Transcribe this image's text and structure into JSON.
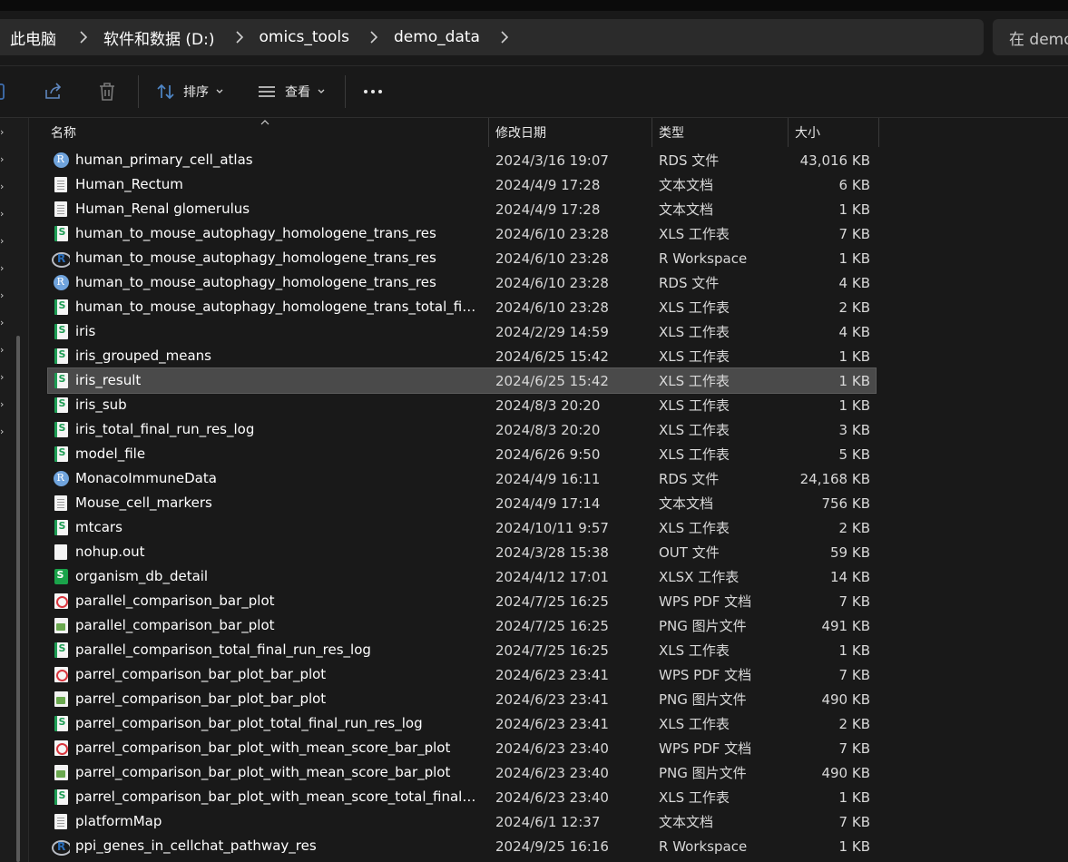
{
  "breadcrumb": [
    "此电脑",
    "软件和数据 (D:)",
    "omics_tools",
    "demo_data"
  ],
  "search_placeholder": "在 demo",
  "toolbar": {
    "sort_label": "排序",
    "view_label": "查看"
  },
  "columns": {
    "name": "名称",
    "date": "修改日期",
    "type": "类型",
    "size": "大小"
  },
  "files": [
    {
      "name": "human_primary_cell_atlas",
      "date": "2024/3/16 19:07",
      "type": "RDS 文件",
      "size": "43,016 KB",
      "icon": "rds"
    },
    {
      "name": "Human_Rectum",
      "date": "2024/4/9 17:28",
      "type": "文本文档",
      "size": "6 KB",
      "icon": "doc"
    },
    {
      "name": "Human_Renal glomerulus",
      "date": "2024/4/9 17:28",
      "type": "文本文档",
      "size": "1 KB",
      "icon": "doc"
    },
    {
      "name": "human_to_mouse_autophagy_homologene_trans_res",
      "date": "2024/6/10 23:28",
      "type": "XLS 工作表",
      "size": "7 KB",
      "icon": "xls"
    },
    {
      "name": "human_to_mouse_autophagy_homologene_trans_res",
      "date": "2024/6/10 23:28",
      "type": "R Workspace",
      "size": "1 KB",
      "icon": "rws"
    },
    {
      "name": "human_to_mouse_autophagy_homologene_trans_res",
      "date": "2024/6/10 23:28",
      "type": "RDS 文件",
      "size": "4 KB",
      "icon": "rds"
    },
    {
      "name": "human_to_mouse_autophagy_homologene_trans_total_fina...",
      "date": "2024/6/10 23:28",
      "type": "XLS 工作表",
      "size": "2 KB",
      "icon": "xls"
    },
    {
      "name": "iris",
      "date": "2024/2/29 14:59",
      "type": "XLS 工作表",
      "size": "4 KB",
      "icon": "xls"
    },
    {
      "name": "iris_grouped_means",
      "date": "2024/6/25 15:42",
      "type": "XLS 工作表",
      "size": "1 KB",
      "icon": "xls"
    },
    {
      "name": "iris_result",
      "date": "2024/6/25 15:42",
      "type": "XLS 工作表",
      "size": "1 KB",
      "icon": "xls",
      "selected": true
    },
    {
      "name": "iris_sub",
      "date": "2024/8/3 20:20",
      "type": "XLS 工作表",
      "size": "1 KB",
      "icon": "xls"
    },
    {
      "name": "iris_total_final_run_res_log",
      "date": "2024/8/3 20:20",
      "type": "XLS 工作表",
      "size": "3 KB",
      "icon": "xls"
    },
    {
      "name": "model_file",
      "date": "2024/6/26 9:50",
      "type": "XLS 工作表",
      "size": "5 KB",
      "icon": "xls"
    },
    {
      "name": "MonacoImmuneData",
      "date": "2024/4/9 16:11",
      "type": "RDS 文件",
      "size": "24,168 KB",
      "icon": "rds"
    },
    {
      "name": "Mouse_cell_markers",
      "date": "2024/4/9 17:14",
      "type": "文本文档",
      "size": "756 KB",
      "icon": "doc"
    },
    {
      "name": "mtcars",
      "date": "2024/10/11 9:57",
      "type": "XLS 工作表",
      "size": "2 KB",
      "icon": "xls"
    },
    {
      "name": "nohup.out",
      "date": "2024/3/28 15:38",
      "type": "OUT 文件",
      "size": "59 KB",
      "icon": "blank"
    },
    {
      "name": "organism_db_detail",
      "date": "2024/4/12 17:01",
      "type": "XLSX 工作表",
      "size": "14 KB",
      "icon": "xlsx"
    },
    {
      "name": "parallel_comparison_bar_plot",
      "date": "2024/7/25 16:25",
      "type": "WPS PDF 文档",
      "size": "7 KB",
      "icon": "pdf"
    },
    {
      "name": "parallel_comparison_bar_plot",
      "date": "2024/7/25 16:25",
      "type": "PNG 图片文件",
      "size": "491 KB",
      "icon": "png"
    },
    {
      "name": "parallel_comparison_total_final_run_res_log",
      "date": "2024/7/25 16:25",
      "type": "XLS 工作表",
      "size": "1 KB",
      "icon": "xls"
    },
    {
      "name": "parrel_comparison_bar_plot_bar_plot",
      "date": "2024/6/23 23:41",
      "type": "WPS PDF 文档",
      "size": "7 KB",
      "icon": "pdf"
    },
    {
      "name": "parrel_comparison_bar_plot_bar_plot",
      "date": "2024/6/23 23:41",
      "type": "PNG 图片文件",
      "size": "490 KB",
      "icon": "png"
    },
    {
      "name": "parrel_comparison_bar_plot_total_final_run_res_log",
      "date": "2024/6/23 23:41",
      "type": "XLS 工作表",
      "size": "2 KB",
      "icon": "xls"
    },
    {
      "name": "parrel_comparison_bar_plot_with_mean_score_bar_plot",
      "date": "2024/6/23 23:40",
      "type": "WPS PDF 文档",
      "size": "7 KB",
      "icon": "pdf"
    },
    {
      "name": "parrel_comparison_bar_plot_with_mean_score_bar_plot",
      "date": "2024/6/23 23:40",
      "type": "PNG 图片文件",
      "size": "490 KB",
      "icon": "png"
    },
    {
      "name": "parrel_comparison_bar_plot_with_mean_score_total_final_r...",
      "date": "2024/6/23 23:40",
      "type": "XLS 工作表",
      "size": "1 KB",
      "icon": "xls"
    },
    {
      "name": "platformMap",
      "date": "2024/6/1 12:37",
      "type": "文本文档",
      "size": "7 KB",
      "icon": "doc"
    },
    {
      "name": "ppi_genes_in_cellchat_pathway_res",
      "date": "2024/9/25 16:16",
      "type": "R Workspace",
      "size": "1 KB",
      "icon": "rws"
    }
  ]
}
